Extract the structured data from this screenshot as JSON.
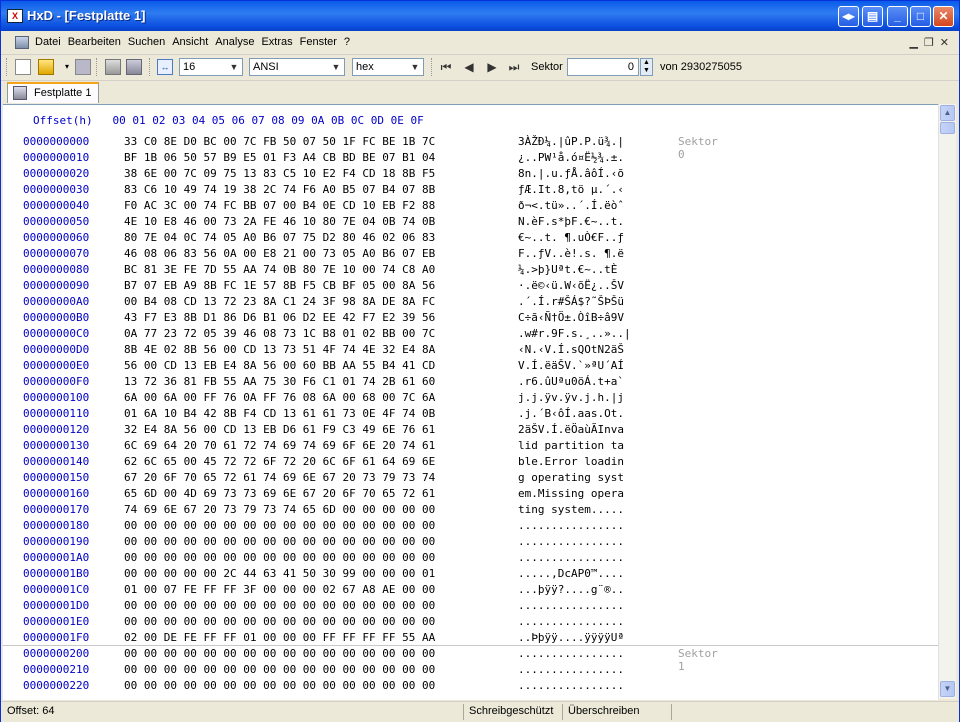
{
  "window": {
    "title": "HxD - [Festplatte 1]",
    "app_icon_glyph": "X"
  },
  "menu": [
    "Datei",
    "Bearbeiten",
    "Suchen",
    "Ansicht",
    "Analyse",
    "Extras",
    "Fenster",
    "?"
  ],
  "toolbar": {
    "bytes_per_row": "16",
    "charset": "ANSI",
    "offset_base": "hex",
    "sektor_label": "Sektor",
    "sektor_value": "0",
    "von_label": "von 2930275055"
  },
  "tab": {
    "label": "Festplatte 1"
  },
  "hex": {
    "header": "Offset(h)   00 01 02 03 04 05 06 07 08 09 0A 0B 0C 0D 0E 0F",
    "rows": [
      {
        "off": "0000000000",
        "hex": "33 C0 8E D0 BC 00 7C FB 50 07 50 1F FC BE 1B 7C",
        "asc": "3ÀŽÐ¼.|ûP.P.ü¾.|"
      },
      {
        "off": "0000000010",
        "hex": "BF 1B 06 50 57 B9 E5 01 F3 A4 CB BD BE 07 B1 04",
        "asc": "¿..PW¹å.ó¤Ë½¾.±."
      },
      {
        "off": "0000000020",
        "hex": "38 6E 00 7C 09 75 13 83 C5 10 E2 F4 CD 18 8B F5",
        "asc": "8n.|.u.ƒÅ.âôÍ.‹õ"
      },
      {
        "off": "0000000030",
        "hex": "83 C6 10 49 74 19 38 2C 74 F6 A0 B5 07 B4 07 8B",
        "asc": "ƒÆ.It.8,tö µ.´.‹"
      },
      {
        "off": "0000000040",
        "hex": "F0 AC 3C 00 74 FC BB 07 00 B4 0E CD 10 EB F2 88",
        "asc": "ð¬<.tü»..´.Í.ëòˆ"
      },
      {
        "off": "0000000050",
        "hex": "4E 10 E8 46 00 73 2A FE 46 10 80 7E 04 0B 74 0B",
        "asc": "N.èF.s*þF.€~..t."
      },
      {
        "off": "0000000060",
        "hex": "80 7E 04 0C 74 05 A0 B6 07 75 D2 80 46 02 06 83",
        "asc": "€~..t. ¶.uÒ€F..ƒ"
      },
      {
        "off": "0000000070",
        "hex": "46 08 06 83 56 0A 00 E8 21 00 73 05 A0 B6 07 EB",
        "asc": "F..ƒV..è!.s. ¶.ë"
      },
      {
        "off": "0000000080",
        "hex": "BC 81 3E FE 7D 55 AA 74 0B 80 7E 10 00 74 C8 A0",
        "asc": "¼.>þ}Uªt.€~..tÈ "
      },
      {
        "off": "0000000090",
        "hex": "B7 07 EB A9 8B FC 1E 57 8B F5 CB BF 05 00 8A 56",
        "asc": "·.ë©‹ü.W‹õË¿..ŠV"
      },
      {
        "off": "00000000A0",
        "hex": "00 B4 08 CD 13 72 23 8A C1 24 3F 98 8A DE 8A FC",
        "asc": ".´.Í.r#ŠÁ$?˜ŠÞŠü"
      },
      {
        "off": "00000000B0",
        "hex": "43 F7 E3 8B D1 86 D6 B1 06 D2 EE 42 F7 E2 39 56",
        "asc": "C÷ã‹Ñ†Ö±.ÒîB÷â9V"
      },
      {
        "off": "00000000C0",
        "hex": "0A 77 23 72 05 39 46 08 73 1C B8 01 02 BB 00 7C",
        ".w#r.9F.s.¸..»..|": ""
      },
      {
        "off": "00000000D0",
        "hex": "8B 4E 02 8B 56 00 CD 13 73 51 4F 74 4E 32 E4 8A",
        "asc": "‹N.‹V.Í.sQOtN2äŠ"
      },
      {
        "off": "00000000E0",
        "hex": "56 00 CD 13 EB E4 8A 56 00 60 BB AA 55 B4 41 CD",
        "asc": "V.Í.ëäŠV.`»ªU´AÍ"
      },
      {
        "off": "00000000F0",
        "hex": "13 72 36 81 FB 55 AA 75 30 F6 C1 01 74 2B 61 60",
        "asc": ".r6.ûUªu0öÁ.t+a`"
      },
      {
        "off": "0000000100",
        "hex": "6A 00 6A 00 FF 76 0A FF 76 08 6A 00 68 00 7C 6A",
        "asc": "j.j.ÿv.ÿv.j.h.|j"
      },
      {
        "off": "0000000110",
        "hex": "01 6A 10 B4 42 8B F4 CD 13 61 61 73 0E 4F 74 0B",
        "asc": ".j.´B‹ôÍ.aas.Ot."
      },
      {
        "off": "0000000120",
        "hex": "32 E4 8A 56 00 CD 13 EB D6 61 F9 C3 49 6E 76 61",
        "asc": "2äŠV.Í.ëÖaùÃInva"
      },
      {
        "off": "0000000130",
        "hex": "6C 69 64 20 70 61 72 74 69 74 69 6F 6E 20 74 61",
        "asc": "lid partition ta"
      },
      {
        "off": "0000000140",
        "hex": "62 6C 65 00 45 72 72 6F 72 20 6C 6F 61 64 69 6E",
        "asc": "ble.Error loadin"
      },
      {
        "off": "0000000150",
        "hex": "67 20 6F 70 65 72 61 74 69 6E 67 20 73 79 73 74",
        "asc": "g operating syst"
      },
      {
        "off": "0000000160",
        "hex": "65 6D 00 4D 69 73 73 69 6E 67 20 6F 70 65 72 61",
        "asc": "em.Missing opera"
      },
      {
        "off": "0000000170",
        "hex": "74 69 6E 67 20 73 79 73 74 65 6D 00 00 00 00 00",
        "asc": "ting system....."
      },
      {
        "off": "0000000180",
        "hex": "00 00 00 00 00 00 00 00 00 00 00 00 00 00 00 00",
        "asc": "................"
      },
      {
        "off": "0000000190",
        "hex": "00 00 00 00 00 00 00 00 00 00 00 00 00 00 00 00",
        "asc": "................"
      },
      {
        "off": "00000001A0",
        "hex": "00 00 00 00 00 00 00 00 00 00 00 00 00 00 00 00",
        "asc": "................"
      },
      {
        "off": "00000001B0",
        "hex": "00 00 00 00 00 2C 44 63 41 50 30 99 00 00 00 01",
        "asc": ".....,DcAP0™...."
      },
      {
        "off": "00000001C0",
        "hex": "01 00 07 FE FF FF 3F 00 00 00 02 67 A8 AE 00 00",
        "asc": "...þÿÿ?....g¨®.."
      },
      {
        "off": "00000001D0",
        "hex": "00 00 00 00 00 00 00 00 00 00 00 00 00 00 00 00",
        "asc": "................"
      },
      {
        "off": "00000001E0",
        "hex": "00 00 00 00 00 00 00 00 00 00 00 00 00 00 00 00",
        "asc": "................"
      },
      {
        "off": "00000001F0",
        "hex": "02 00 DE FE FF FF 01 00 00 00 FF FF FF FF 55 AA",
        "asc": "..Þþÿÿ....ÿÿÿÿUª"
      },
      {
        "off": "0000000200",
        "hex": "00 00 00 00 00 00 00 00 00 00 00 00 00 00 00 00",
        "asc": "................"
      },
      {
        "off": "0000000210",
        "hex": "00 00 00 00 00 00 00 00 00 00 00 00 00 00 00 00",
        "asc": "................"
      },
      {
        "off": "0000000220",
        "hex": "00 00 00 00 00 00 00 00 00 00 00 00 00 00 00 00",
        "asc": "................"
      }
    ],
    "sector_labels": [
      {
        "label": "Sektor 0"
      },
      {
        "label": "Sektor 1"
      }
    ]
  },
  "status": {
    "offset": "Offset: 64",
    "readonly": "Schreibgeschützt",
    "mode": "Überschreiben"
  }
}
